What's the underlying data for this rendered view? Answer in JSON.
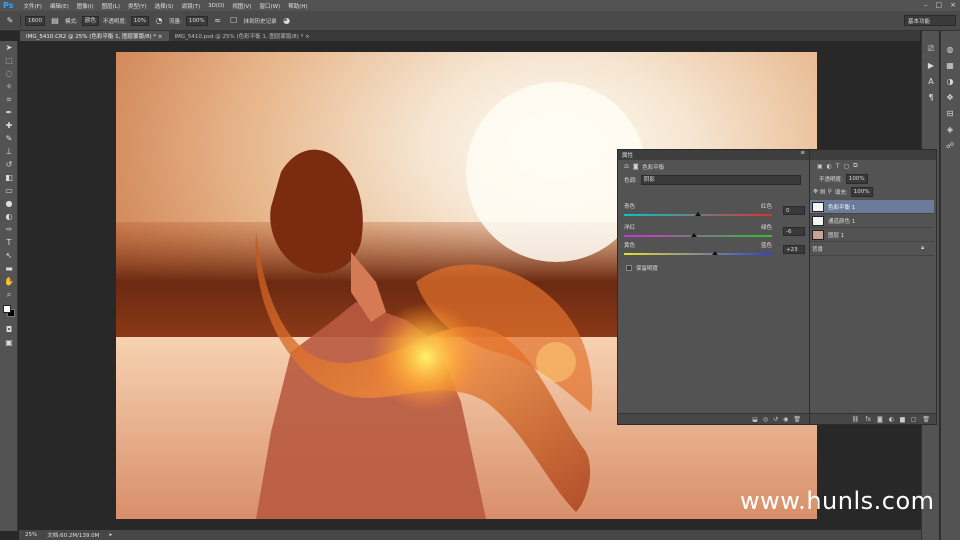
{
  "app": {
    "logo": "Ps"
  },
  "menu": [
    "文件(F)",
    "编辑(E)",
    "图像(I)",
    "图层(L)",
    "类型(Y)",
    "选择(S)",
    "滤镜(T)",
    "3D(D)",
    "视图(V)",
    "窗口(W)",
    "帮助(H)"
  ],
  "window_controls": [
    "–",
    "□",
    "×"
  ],
  "options": {
    "brush_size": "1600",
    "mode_label": "模式:",
    "mode_value": "颜色",
    "opacity_label": "不透明度:",
    "opacity_value": "10%",
    "flow_label": "流量:",
    "flow_value": "100%",
    "history_label": "抹到历史记录",
    "workspace": "基本功能"
  },
  "tabs": [
    {
      "label": "IMG_5410.CR2 @ 25% (色彩平衡 1, 图层蒙版/8) *  ×"
    },
    {
      "label": "IMG_5410.psd @ 25% (色彩平衡 1, 图层蒙版/8) *  ×"
    }
  ],
  "status": {
    "zoom": "25%",
    "doc": "文档:60.2M/139.0M"
  },
  "properties": {
    "tab": "属性",
    "title": "色彩平衡",
    "tone_label": "色调:",
    "tone_value": "阴影",
    "sliders": [
      {
        "left": "青色",
        "right": "红色",
        "value": "0",
        "pos": 0.5
      },
      {
        "left": "洋红",
        "right": "绿色",
        "value": "-6",
        "pos": 0.47
      },
      {
        "left": "黄色",
        "right": "蓝色",
        "value": "+23",
        "pos": 0.615
      }
    ],
    "preserve_label": "保留明度"
  },
  "layers": {
    "opacity_label": "不透明度:",
    "opacity_value": "100%",
    "fill_label": "填充:",
    "fill_value": "100%",
    "items": [
      {
        "name": "色彩平衡 1",
        "selected": true
      },
      {
        "name": "通道颜色 1",
        "selected": false
      },
      {
        "name": "图层 1",
        "selected": false
      },
      {
        "name": "背景",
        "selected": false
      }
    ]
  },
  "watermark": "www.hunls.com",
  "colors": {
    "selection": "#6b7b9a",
    "ps_blue": "#31a8ff"
  }
}
